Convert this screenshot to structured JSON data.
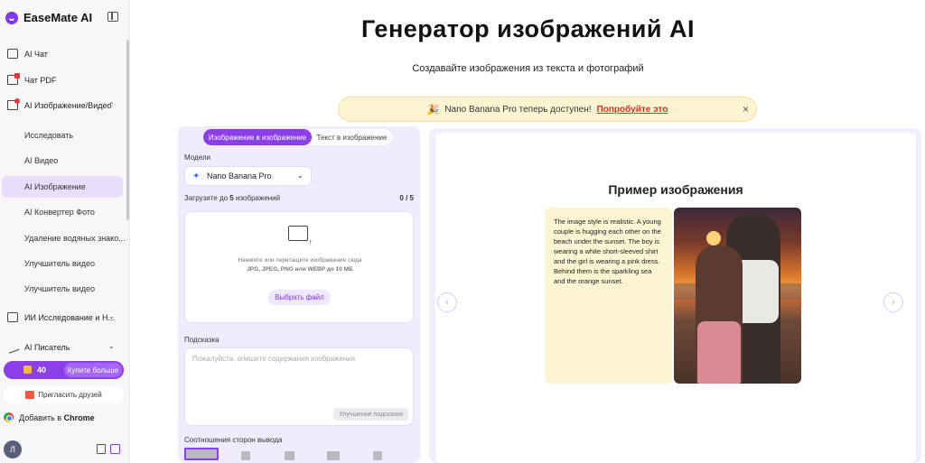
{
  "brand": {
    "name": "EaseMate AI"
  },
  "sidebar": {
    "items": [
      {
        "label": "AI Чат"
      },
      {
        "label": "Чат PDF"
      },
      {
        "label": "AI Изображение/Видео"
      },
      {
        "label": "Исследовать"
      },
      {
        "label": "AI Видео"
      },
      {
        "label": "AI Изображение"
      },
      {
        "label": "AI Конвертер Фото"
      },
      {
        "label": "Удаление водяных знако..."
      },
      {
        "label": "Улучшитель видео"
      },
      {
        "label": "Улучшитель видео"
      },
      {
        "label": "ИИ Исследование и Н..."
      },
      {
        "label": "AI Писатель"
      }
    ],
    "credits": {
      "count": "40",
      "buy_label": "Купите больше"
    },
    "invite_label": "Пригласить друзей",
    "chrome": {
      "prefix": "Добавить в",
      "name": "Chrome"
    },
    "avatar_letter": "Л"
  },
  "main": {
    "title": "Генератор изображений AI",
    "subtitle": "Создавайте изображения из текста и фотографий",
    "banner": {
      "emoji": "🎉",
      "brand": "Nano Banana Pro",
      "text": "теперь доступен!",
      "link": "Попробуйте это",
      "close": "×"
    }
  },
  "form": {
    "tabs": [
      "Изображение в изображение",
      "Текст в изображение"
    ],
    "models_label": "Модели",
    "model_name": "Nano Banana Pro",
    "upload_label_pre": "Загрузите до",
    "upload_label_num": "5",
    "upload_label_post": "изображений",
    "upload_count": "0 / 5",
    "upload_hint_1": "Нажмите или перетащите изображение сюда",
    "upload_hint_2": "JPG, JPEG, PNG или WEBP до 10 МБ",
    "pick_button": "Выбрать файл",
    "prompt_label": "Подсказка",
    "prompt_placeholder": "Пожалуйста, опишите содержания изображения",
    "improve_button": "Улучшение подсказки",
    "ratio_label": "Соотношения сторон вывода"
  },
  "example": {
    "title": "Пример изображения",
    "text": "The image style is realistic. A young couple is hugging each other on the beach under the sunset. The boy is wearing a white short-sleeved shirt and the girl is wearing a pink dress. Behind them is the sparkling sea and the orange sunset.",
    "prev": "‹",
    "next": "›"
  },
  "colors": {
    "accent": "#8b3fe8",
    "banner_bg": "#fdf4d2",
    "link": "#d93025"
  }
}
